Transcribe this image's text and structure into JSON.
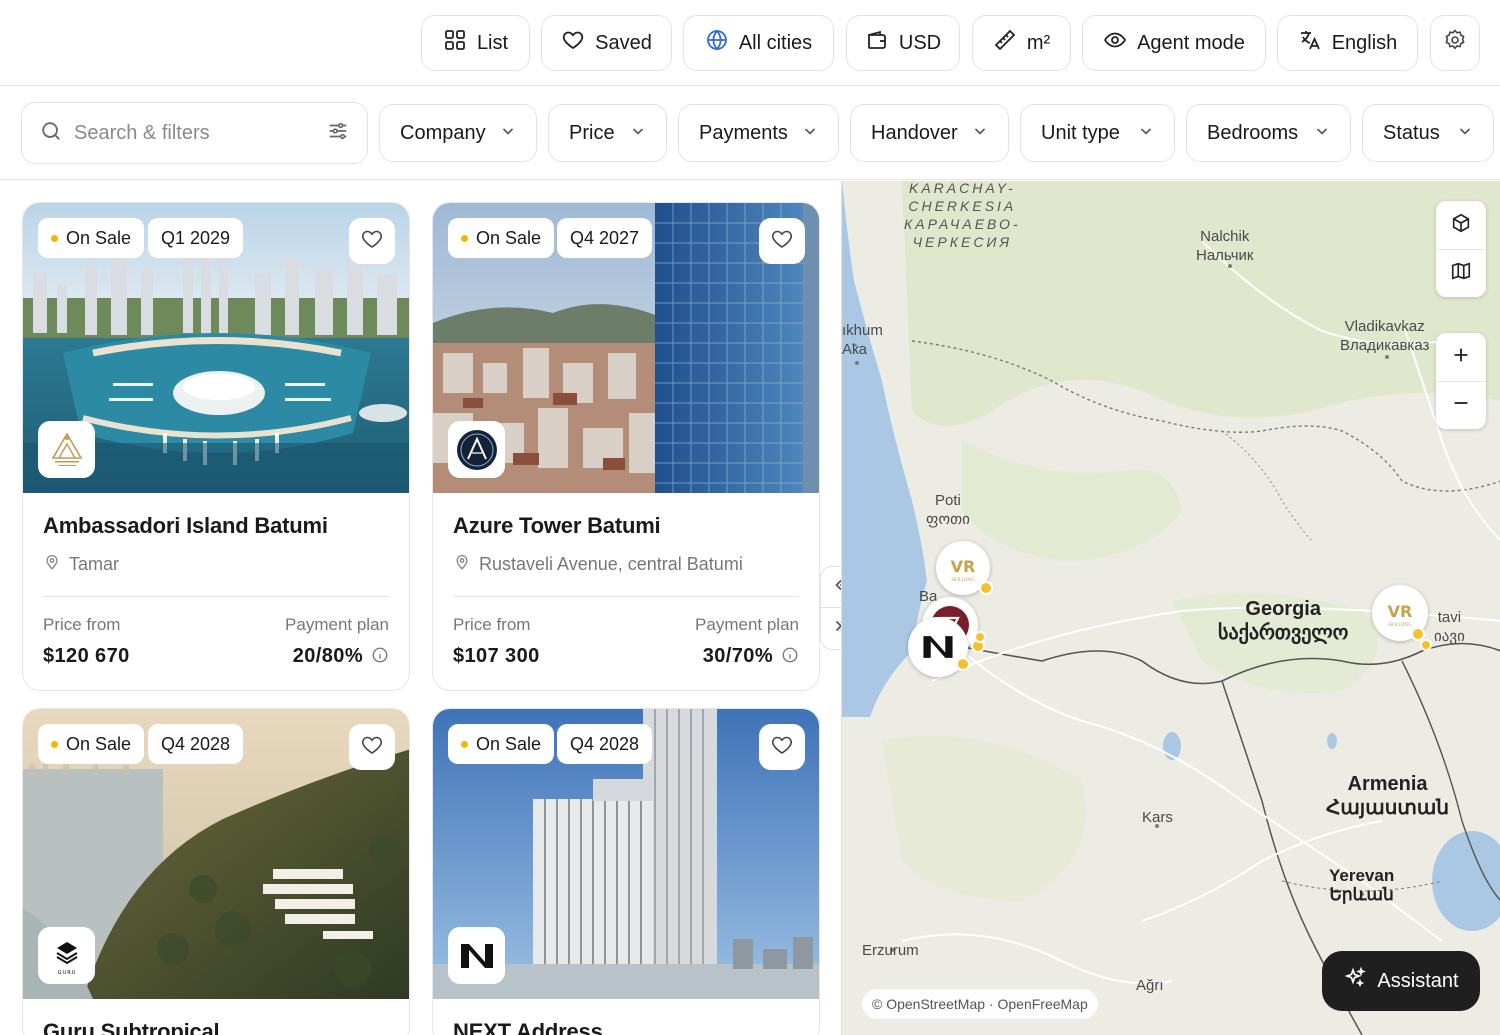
{
  "topbar": {
    "list_label": "List",
    "saved_label": "Saved",
    "cities_label": "All cities",
    "currency_label": "USD",
    "unit_label": "m²",
    "agent_label": "Agent mode",
    "language_label": "English"
  },
  "filters": {
    "search_placeholder": "Search & filters",
    "items": [
      "Company",
      "Price",
      "Payments",
      "Handover",
      "Unit type",
      "Bedrooms",
      "Status"
    ]
  },
  "labels": {
    "price_from": "Price from",
    "payment_plan": "Payment plan"
  },
  "cards": [
    {
      "status": "On Sale",
      "handover": "Q1 2029",
      "title": "Ambassadori Island Batumi",
      "location": "Tamar",
      "price": "$120 670",
      "payment": "20/80%"
    },
    {
      "status": "On Sale",
      "handover": "Q4 2027",
      "title": "Azure Tower Batumi",
      "location": "Rustaveli Avenue, central Batumi",
      "price": "$107 300",
      "payment": "30/70%"
    },
    {
      "status": "On Sale",
      "handover": "Q4 2028",
      "title": "Guru Subtropical",
      "location": "",
      "price": "",
      "payment": ""
    },
    {
      "status": "On Sale",
      "handover": "Q4 2028",
      "title": "NEXT Address",
      "location": "",
      "price": "",
      "payment": ""
    }
  ],
  "map": {
    "labels": {
      "karachay": "KARACHAY-\nCHERKESIA\nКАРАЧАЕВО-\nЧЕРКЕСИЯ",
      "nalchik": "Nalchik\nНальчик",
      "sukhum": "ıkhum\nАҟа",
      "vladikavkaz": "Vladikavkaz\nВладикавказ",
      "poti": "Poti\nფოთი",
      "batumi": "Ba",
      "georgia": "Georgia\nსაქართველო",
      "tbilisi": "tavi\nიავი",
      "armenia": "Armenia\nՀայաստան",
      "kars": "Kars",
      "yerevan": "Yerevan\nԵրևան",
      "erzurum": "Erzurum",
      "agri": "Ağrı"
    },
    "attribution": "© OpenStreetMap · OpenFreeMap",
    "assistant_label": "Assistant",
    "colors": {
      "land": "#ecebe4",
      "sea": "#aac8e4",
      "green": "#dfe8cc",
      "border": "#7a7a7a"
    }
  },
  "brand_logos": {
    "ambassadori": "AMBASSADORI",
    "vr_holding": "VR",
    "vr_holding_sub": "HOLDING",
    "guru": "GURU",
    "next": "N"
  },
  "icons": [
    "grid-icon",
    "heart-icon",
    "globe-icon",
    "wallet-icon",
    "ruler-icon",
    "eye-icon",
    "translate-icon",
    "gear-icon",
    "search-icon",
    "sliders-icon",
    "chevron-down-icon",
    "location-pin-icon",
    "info-icon",
    "cube-icon",
    "map-icon",
    "plus-icon",
    "minus-icon",
    "sparkle-icon"
  ]
}
